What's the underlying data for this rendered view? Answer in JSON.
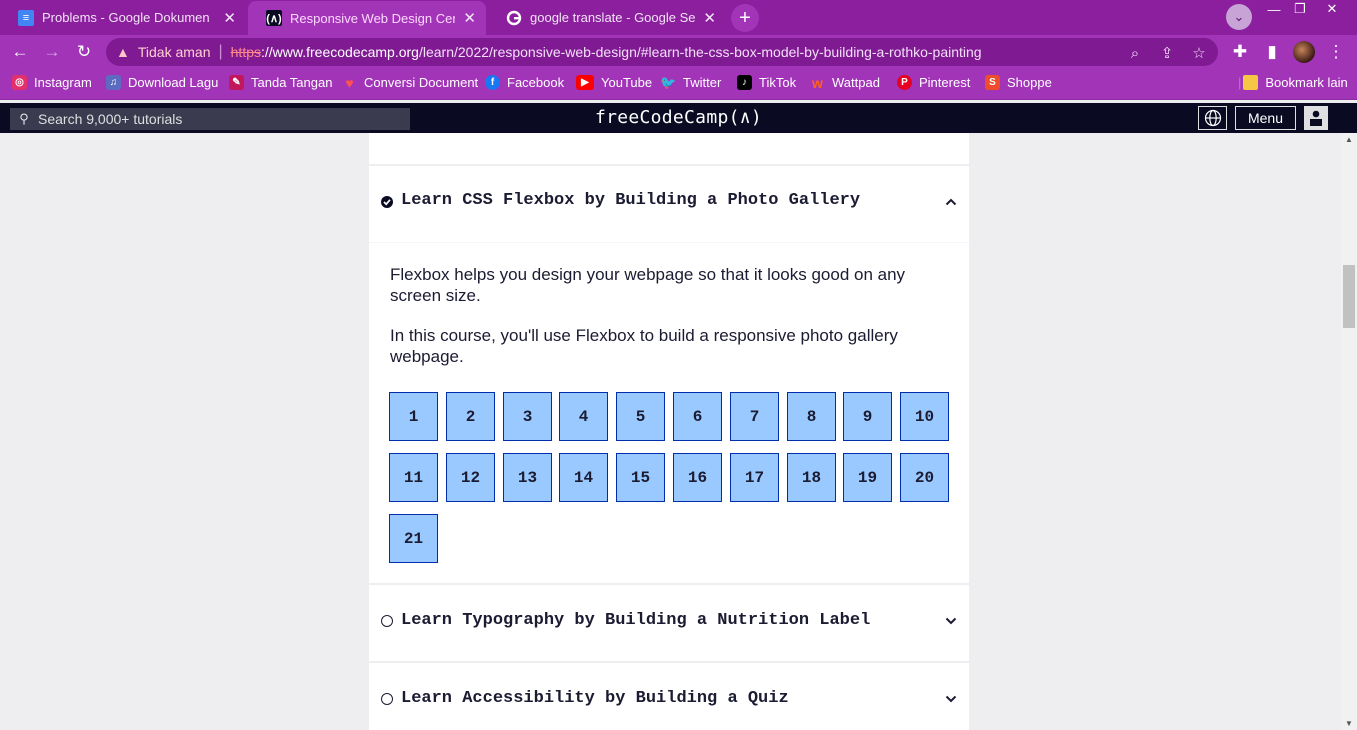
{
  "browser": {
    "tabs": [
      {
        "title": "Problems - Google Dokumen",
        "icon": "google-docs-icon"
      },
      {
        "title": "Responsive Web Design Certifica",
        "icon": "freecodecamp-icon"
      },
      {
        "title": "google translate - Google Search",
        "icon": "google-icon"
      }
    ],
    "active_tab": 1,
    "security_label": "Tidak aman",
    "url_scheme": "https",
    "url_host": "://www.freecodecamp.org",
    "url_path": "/learn/2022/responsive-web-design/#learn-the-css-box-model-by-building-a-rothko-painting",
    "bookmarks": [
      {
        "label": "Instagram",
        "icon": "instagram-icon",
        "color": "#e1306c"
      },
      {
        "label": "Download Lagu",
        "icon": "music-icon",
        "color": "#5c6bc0"
      },
      {
        "label": "Tanda Tangan",
        "icon": "signature-icon",
        "color": "#c2185b"
      },
      {
        "label": "Conversi Document",
        "icon": "heart-icon",
        "color": "#e53935"
      },
      {
        "label": "Facebook",
        "icon": "facebook-icon",
        "color": "#1877f2"
      },
      {
        "label": "YouTube",
        "icon": "youtube-icon",
        "color": "#ff0000"
      },
      {
        "label": "Twitter",
        "icon": "twitter-icon",
        "color": "#1da1f2"
      },
      {
        "label": "TikTok",
        "icon": "tiktok-icon",
        "color": "#000000"
      },
      {
        "label": "Wattpad",
        "icon": "wattpad-icon",
        "color": "#ff6122"
      },
      {
        "label": "Pinterest",
        "icon": "pinterest-icon",
        "color": "#e60023"
      },
      {
        "label": "Shoppe",
        "icon": "shopee-icon",
        "color": "#ee4d2d"
      }
    ],
    "other_bookmarks": "Bookmark lain",
    "accent_color": "#a234b8"
  },
  "fcc": {
    "search_placeholder": "Search 9,000+ tutorials",
    "logo": "freeCodeCamp(🔥)",
    "logo_text": "freeCodeCamp",
    "menu_label": "Menu"
  },
  "blocks": [
    {
      "title": "Learn CSS Flexbox by Building a Photo Gallery",
      "completed": true,
      "expanded": true,
      "intro": [
        "Flexbox helps you design your webpage so that it looks good on any screen size.",
        "In this course, you'll use Flexbox to build a responsive photo gallery webpage."
      ],
      "steps": [
        "1",
        "2",
        "3",
        "4",
        "5",
        "6",
        "7",
        "8",
        "9",
        "10",
        "11",
        "12",
        "13",
        "14",
        "15",
        "16",
        "17",
        "18",
        "19",
        "20",
        "21"
      ]
    },
    {
      "title": "Learn Typography by Building a Nutrition Label",
      "completed": false,
      "expanded": false
    },
    {
      "title": "Learn Accessibility by Building a Quiz",
      "completed": false,
      "expanded": false
    }
  ]
}
